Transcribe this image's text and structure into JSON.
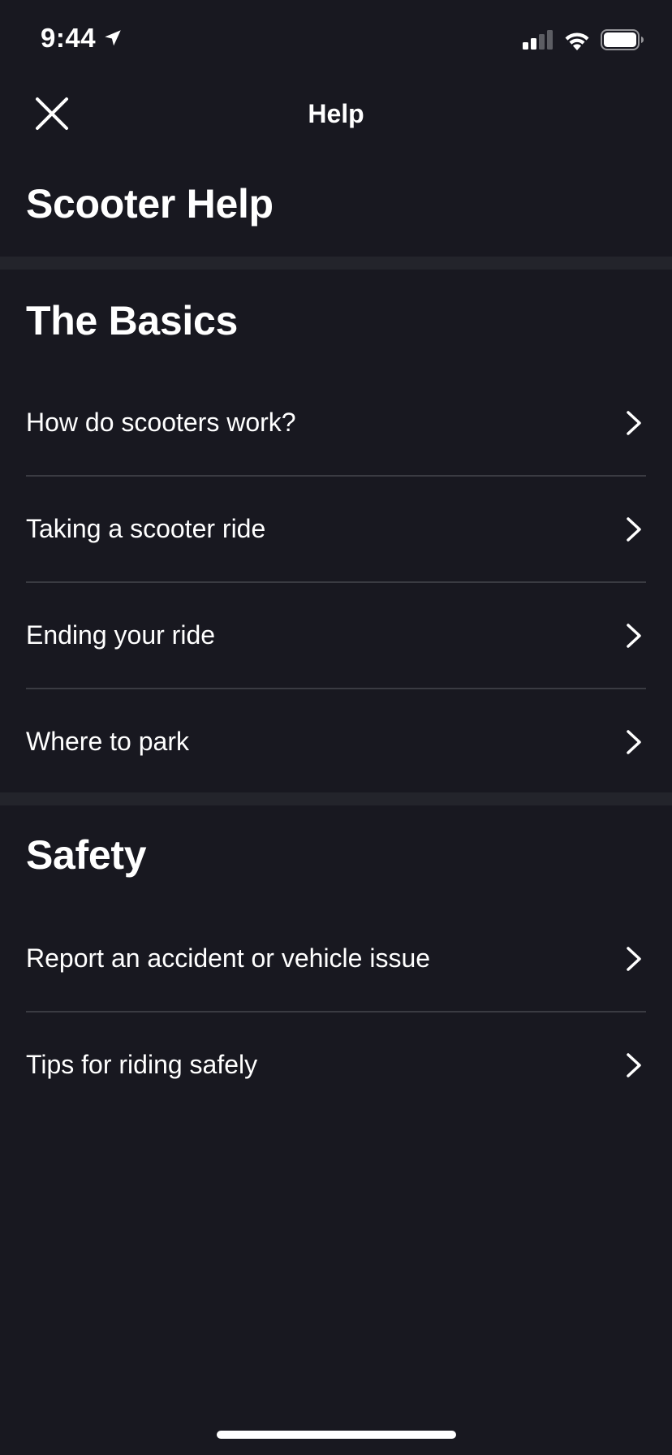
{
  "status_bar": {
    "time": "9:44"
  },
  "nav": {
    "title": "Help"
  },
  "page": {
    "title": "Scooter Help"
  },
  "sections": [
    {
      "title": "The Basics",
      "items": [
        {
          "label": "How do scooters work?"
        },
        {
          "label": "Taking a scooter ride"
        },
        {
          "label": "Ending your ride"
        },
        {
          "label": "Where to park"
        }
      ]
    },
    {
      "title": "Safety",
      "items": [
        {
          "label": "Report an accident or vehicle issue"
        },
        {
          "label": "Tips for riding safely"
        }
      ]
    }
  ],
  "colors": {
    "background": "#181820",
    "divider_band": "#23242b",
    "row_separator": "#3a3b42",
    "text": "#ffffff"
  },
  "icons": {
    "close": "close-icon",
    "chevron": "chevron-right-icon",
    "location": "location-arrow-icon",
    "signal": "cellular-signal-icon",
    "wifi": "wifi-icon",
    "battery": "battery-icon"
  }
}
